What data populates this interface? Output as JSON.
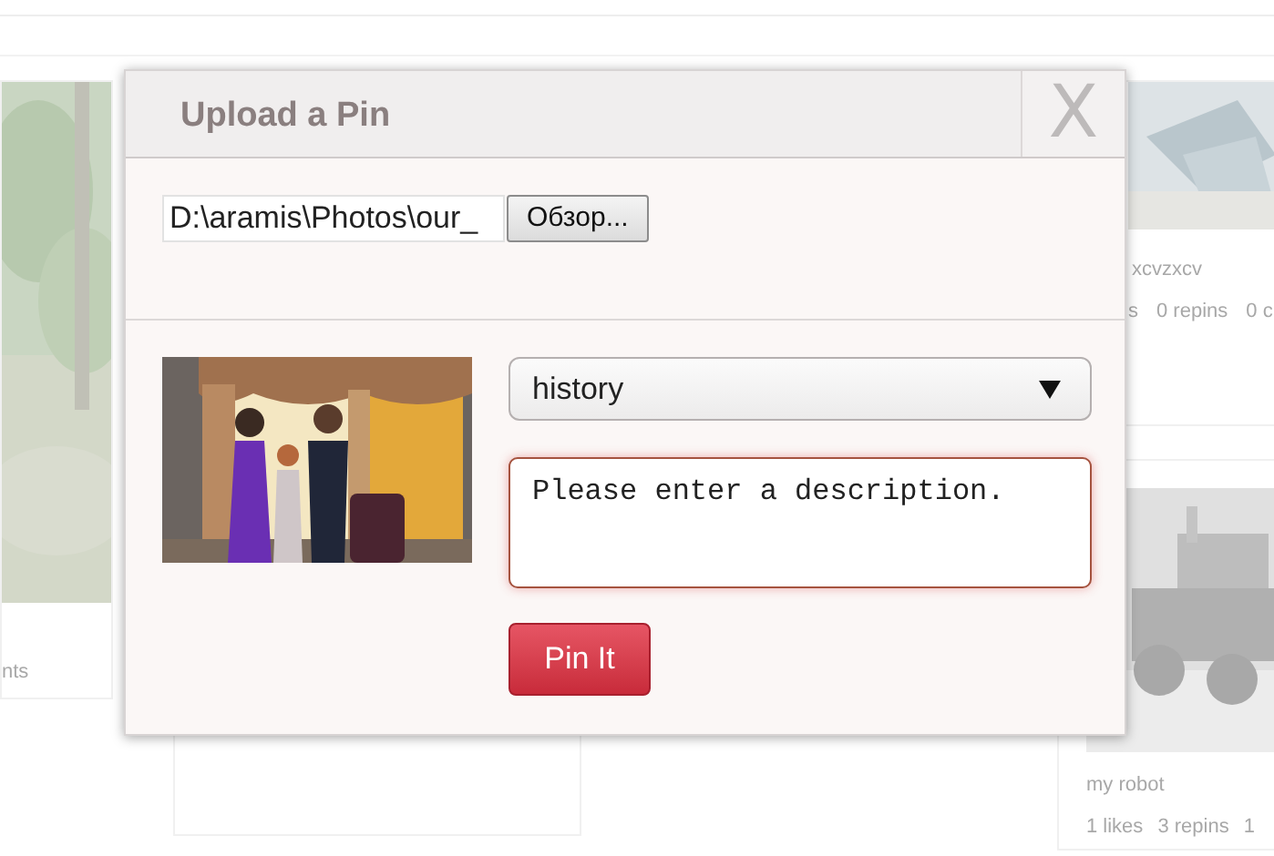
{
  "background_pins": [
    {
      "stats": [
        "nts"
      ]
    },
    {
      "title": "xcvzxcv",
      "stats": [
        "s",
        "0 repins",
        "0 c"
      ]
    },
    {
      "title": "my robot",
      "stats": [
        "1 likes",
        "3 repins",
        "1"
      ]
    }
  ],
  "dialog": {
    "title": "Upload a Pin",
    "close": "X",
    "file_path": "D:\\aramis\\Photos\\our_",
    "browse_button": "Обзор...",
    "board": "history",
    "description": {
      "placeholder": "Please enter a description.",
      "focused": true
    },
    "submit_button": "Pin It"
  }
}
